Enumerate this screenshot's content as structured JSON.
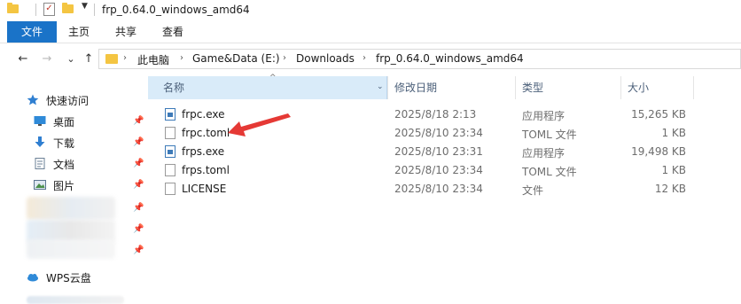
{
  "window": {
    "title": "frp_0.64.0_windows_amd64",
    "props_icon_glyph": "✓",
    "qat_dropdown_glyph": "▼"
  },
  "ribbon": {
    "tabs": [
      "文件",
      "主页",
      "共享",
      "查看"
    ]
  },
  "nav": {
    "back_glyph": "←",
    "forward_glyph": "→",
    "recent_glyph": "⌄",
    "up_glyph": "↑"
  },
  "address": {
    "separator_glyph": "›",
    "breadcrumbs": [
      "此电脑",
      "Game&Data (E:)",
      "Downloads",
      "frp_0.64.0_windows_amd64"
    ]
  },
  "sidebar": {
    "pin_glyph": "📌",
    "items": [
      {
        "label": "快速访问",
        "icon": "star-icon"
      },
      {
        "label": "桌面",
        "icon": "desktop-icon"
      },
      {
        "label": "下载",
        "icon": "download-icon"
      },
      {
        "label": "文档",
        "icon": "documents-icon"
      },
      {
        "label": "图片",
        "icon": "pictures-icon"
      },
      {
        "label": "WPS云盘",
        "icon": "cloud-icon"
      }
    ]
  },
  "file_list": {
    "sort_indicator": "^",
    "columns": [
      "名称",
      "修改日期",
      "类型",
      "大小"
    ],
    "rows": [
      {
        "name": "frpc.exe",
        "modified": "2025/8/18 2:13",
        "type": "应用程序",
        "size": "15,265 KB",
        "icon": "exe-icon"
      },
      {
        "name": "frpc.toml",
        "modified": "2025/8/10 23:34",
        "type": "TOML 文件",
        "size": "1 KB",
        "icon": "document-icon"
      },
      {
        "name": "frps.exe",
        "modified": "2025/8/10 23:31",
        "type": "应用程序",
        "size": "19,498 KB",
        "icon": "exe-icon"
      },
      {
        "name": "frps.toml",
        "modified": "2025/8/10 23:34",
        "type": "TOML 文件",
        "size": "1 KB",
        "icon": "document-icon"
      },
      {
        "name": "LICENSE",
        "modified": "2025/8/10 23:34",
        "type": "文件",
        "size": "12 KB",
        "icon": "document-icon"
      }
    ]
  },
  "colors": {
    "accent": "#1a73c8",
    "annotation_arrow": "#e53935",
    "header_highlight": "#d9ebf9"
  }
}
